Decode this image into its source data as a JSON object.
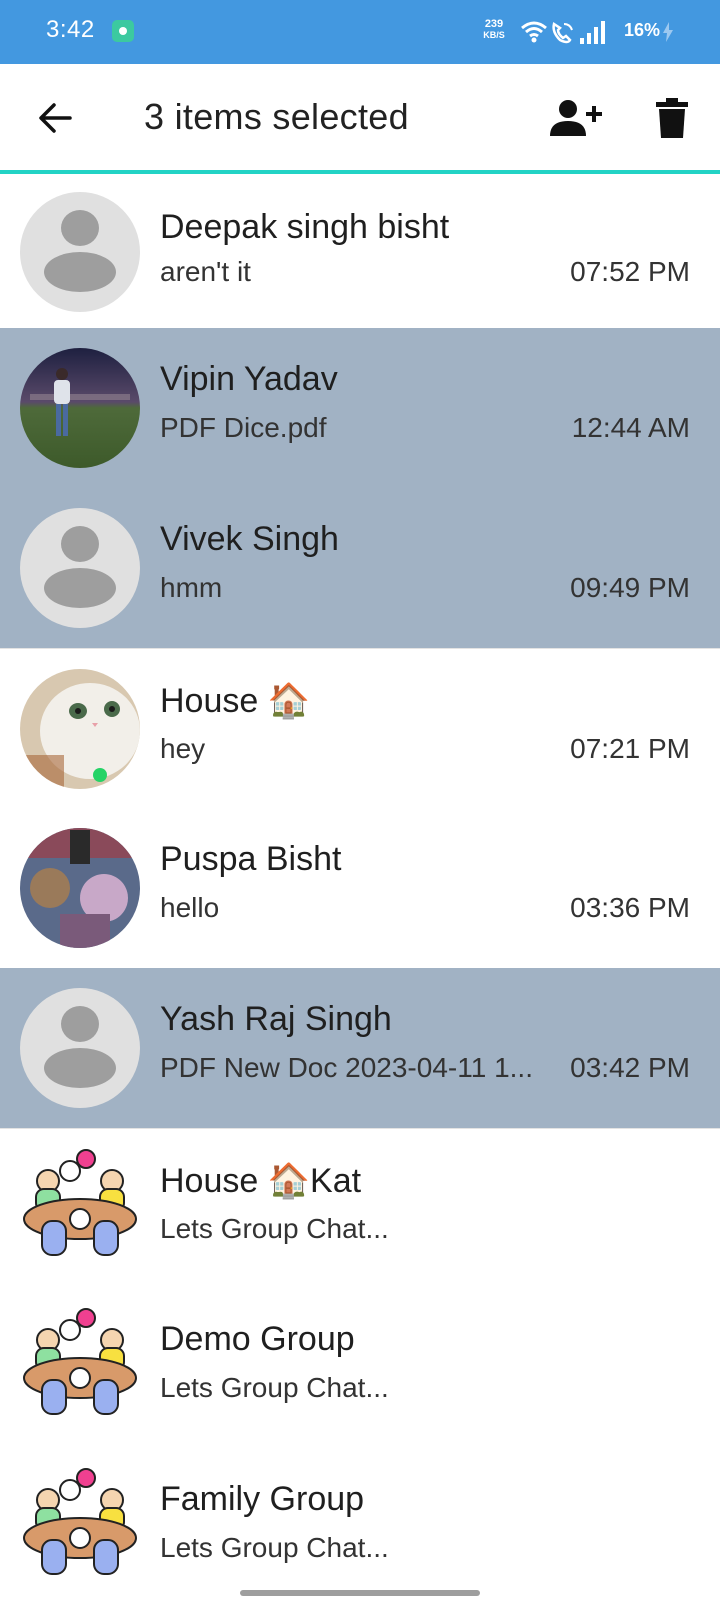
{
  "status_bar": {
    "time": "3:42",
    "network_speed_value": "239",
    "network_speed_unit": "KB/S",
    "battery": "16%",
    "icons": [
      "app-notification-icon",
      "wifi-icon",
      "wifi-call-icon",
      "signal-icon",
      "charging-bolt-icon"
    ]
  },
  "app_bar": {
    "title": "3 items selected",
    "actions": [
      "back-arrow-icon",
      "add-contact-icon",
      "trash-icon"
    ]
  },
  "chats": [
    {
      "name": "Deepak singh bisht",
      "preview": "aren't it",
      "time": "07:52 PM",
      "selected": false,
      "avatar": "default-person-avatar"
    },
    {
      "name": "Vipin Yadav",
      "preview": "PDF Dice.pdf",
      "time": "12:44 AM",
      "selected": true,
      "avatar": "photo-avatar"
    },
    {
      "name": "Vivek Singh",
      "preview": "hmm",
      "time": "09:49 PM",
      "selected": true,
      "avatar": "default-person-avatar"
    },
    {
      "name": "House 🏠",
      "preview": "hey",
      "time": "07:21 PM",
      "selected": false,
      "avatar": "photo-avatar"
    },
    {
      "name": "Puspa Bisht",
      "preview": "hello",
      "time": "03:36 PM",
      "selected": false,
      "avatar": "photo-avatar"
    },
    {
      "name": "Yash Raj Singh",
      "preview": "PDF New Doc 2023-04-11 1...",
      "time": "03:42 PM",
      "selected": true,
      "avatar": "default-person-avatar"
    },
    {
      "name": "House 🏠Kat",
      "preview": "Lets Group Chat...",
      "time": "",
      "selected": false,
      "avatar": "group-chat-avatar"
    },
    {
      "name": "Demo Group",
      "preview": "Lets Group Chat...",
      "time": "",
      "selected": false,
      "avatar": "group-chat-avatar"
    },
    {
      "name": "Family Group",
      "preview": "Lets Group Chat...",
      "time": "",
      "selected": false,
      "avatar": "group-chat-avatar"
    }
  ],
  "colors": {
    "status_bar": "#4398e0",
    "selected_row": "#a1b2c4",
    "app_bar_accent": "#22d3c5",
    "default_avatar_bg": "#e0e0e0",
    "default_avatar_fg": "#9e9e9e"
  }
}
